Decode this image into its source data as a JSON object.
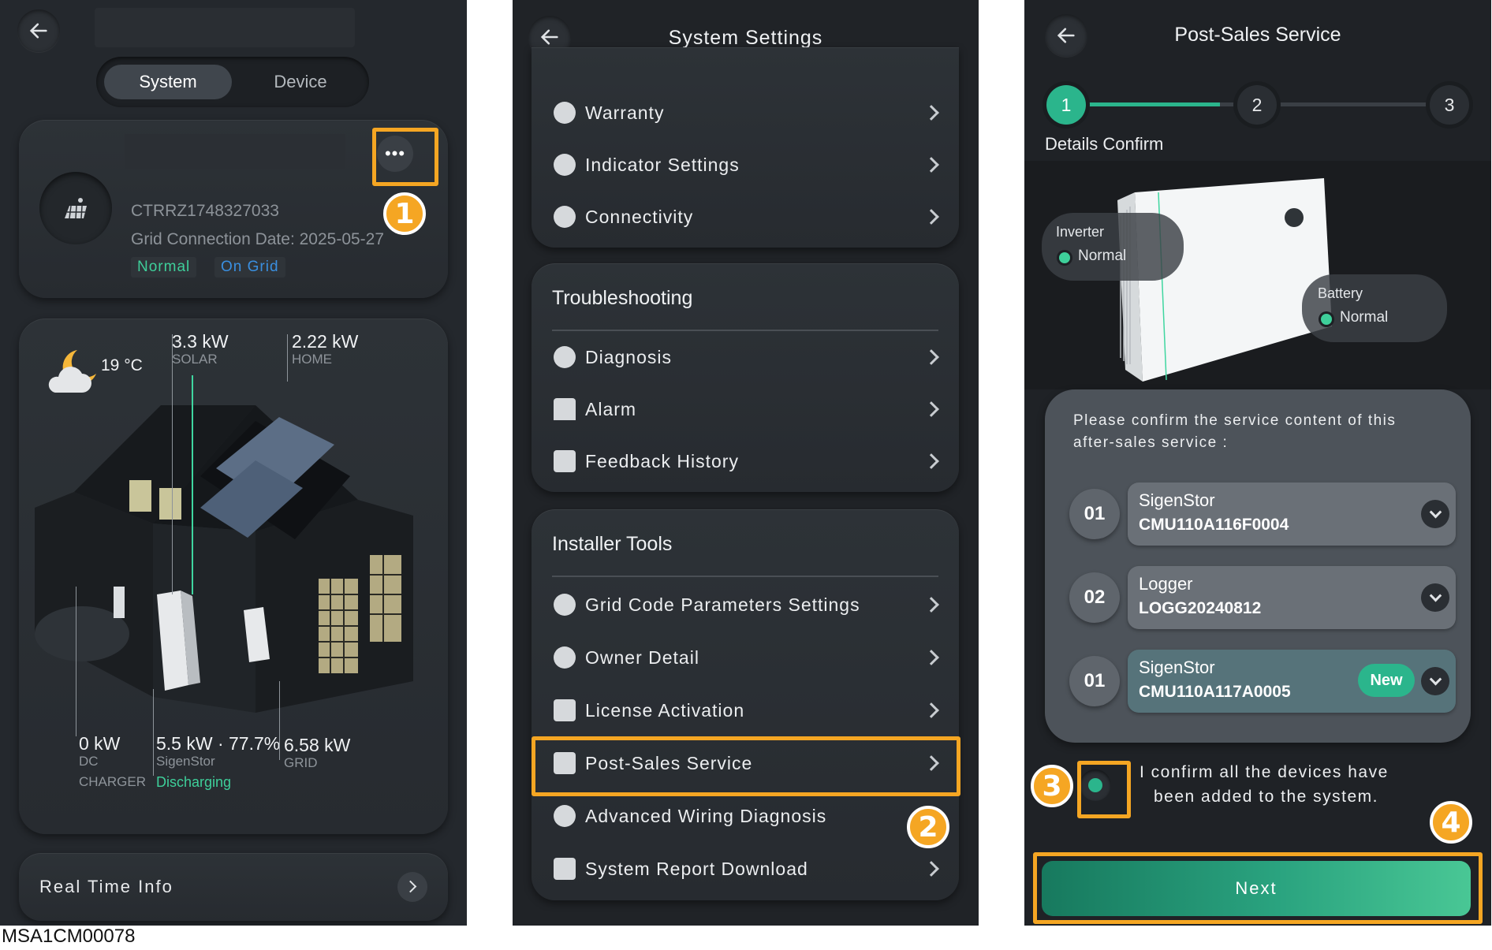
{
  "screen1": {
    "tabs": [
      "System",
      "Device"
    ],
    "active_tab": "System",
    "system_id": "CTRRZ1748327033",
    "grid_date": "Grid Connection Date: 2025-05-27",
    "status_tags": [
      "Normal",
      "On Grid"
    ],
    "weather": "19 °C",
    "flows": {
      "solar_value": "3.3 kW",
      "solar_label": "SOLAR",
      "home_value": "2.22 kW",
      "home_label": "HOME",
      "dc_value": "0 kW",
      "dc_label": "DC",
      "dc_label2": "CHARGER",
      "sigen_value": "5.5 kW · 77.7%",
      "sigen_label": "SigenStor",
      "sigen_status": "Discharging",
      "grid_value": "6.58 kW",
      "grid_label": "GRID"
    },
    "realtime_label": "Real Time Info",
    "badge": "1"
  },
  "screen2": {
    "title": "System Settings",
    "group1": [
      "Warranty",
      "Indicator Settings",
      "Connectivity"
    ],
    "group2_title": "Troubleshooting",
    "group2": [
      "Diagnosis",
      "Alarm",
      "Feedback History"
    ],
    "group3_title": "Installer Tools",
    "group3": [
      "Grid Code Parameters Settings",
      "Owner Detail",
      "License Activation",
      "Post-Sales Service",
      "Advanced Wiring Diagnosis",
      "System Report Download"
    ],
    "badge": "2"
  },
  "screen3": {
    "title": "Post-Sales Service",
    "steps": [
      "1",
      "2",
      "3"
    ],
    "step_label": "Details Confirm",
    "inverter_label": "Inverter",
    "inverter_status": "Normal",
    "battery_label": "Battery",
    "battery_status": "Normal",
    "confirm_prompt": "Please confirm the service content of this after-sales service :",
    "devices": [
      {
        "num": "01",
        "name": "SigenStor",
        "code": "CMU110A116F0004",
        "tag": ""
      },
      {
        "num": "02",
        "name": "Logger",
        "code": "LOGG20240812",
        "tag": ""
      },
      {
        "num": "01",
        "name": "SigenStor",
        "code": "CMU110A117A0005",
        "tag": "New"
      }
    ],
    "confirm_text_1": "I confirm all the devices have",
    "confirm_text_2": "been added to the system.",
    "next_label": "Next",
    "badge3": "3",
    "badge4": "4"
  },
  "caption": "MSA1CM00078",
  "colors": {
    "accent_orange": "#f5a623",
    "accent_green": "#2bb58c",
    "status_green": "#3ecf9a",
    "status_blue": "#3a8fe0"
  }
}
